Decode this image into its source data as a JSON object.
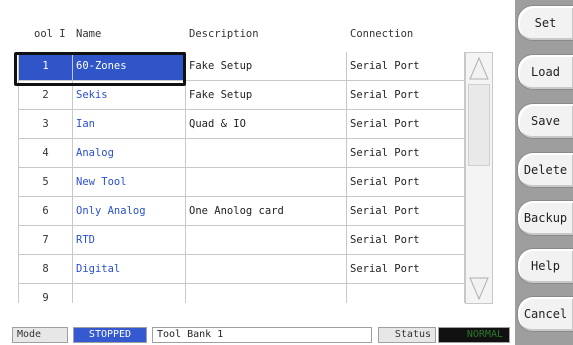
{
  "table": {
    "headers": {
      "num": "ool I",
      "name": "Name",
      "description": "Description",
      "connection": "Connection"
    },
    "rows": [
      {
        "num": "1",
        "name": "60-Zones",
        "description": "Fake Setup",
        "connection": "Serial Port"
      },
      {
        "num": "2",
        "name": "Sekis",
        "description": "Fake Setup",
        "connection": "Serial Port"
      },
      {
        "num": "3",
        "name": "Ian",
        "description": "Quad & IO",
        "connection": "Serial Port"
      },
      {
        "num": "4",
        "name": "Analog",
        "description": "",
        "connection": "Serial Port"
      },
      {
        "num": "5",
        "name": "New Tool",
        "description": "",
        "connection": "Serial Port"
      },
      {
        "num": "6",
        "name": "Only Analog",
        "description": "One Anolog card",
        "connection": "Serial Port"
      },
      {
        "num": "7",
        "name": "RTD",
        "description": "",
        "connection": "Serial Port"
      },
      {
        "num": "8",
        "name": "Digital",
        "description": "",
        "connection": "Serial Port"
      },
      {
        "num": "9",
        "name": "",
        "description": "",
        "connection": ""
      }
    ],
    "selected_row": "1"
  },
  "buttons": {
    "set": "Set",
    "load": "Load",
    "save": "Save",
    "delete": "Delete",
    "backup": "Backup",
    "help": "Help",
    "cancel": "Cancel"
  },
  "statusbar": {
    "mode_label": "Mode",
    "mode_value": "STOPPED",
    "bank": "Tool Bank 1",
    "status_label": "Status",
    "status_value": "NORMAL"
  },
  "colors": {
    "selection": "#2f55c9",
    "link_text": "#2a4fd0",
    "stopped_bg": "#3559cf",
    "normal_text": "#2a7a2a",
    "panel": "#9e9e9e"
  }
}
